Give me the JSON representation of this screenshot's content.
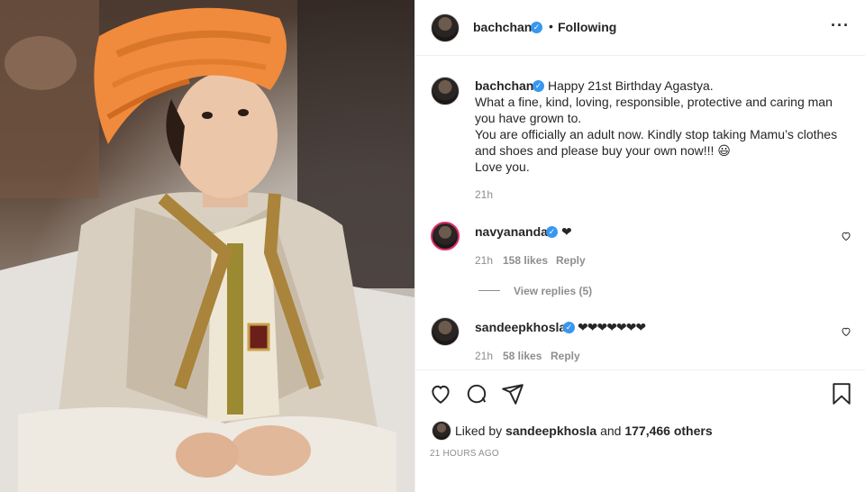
{
  "post": {
    "author": "bachchan",
    "follow_status": "Following",
    "caption_user": "bachchan",
    "caption_lines": [
      "Happy 21st Birthday Agastya.",
      "What a fine, kind, loving, responsible, protective and caring man",
      "you have grown to.",
      "You are officially an adult now. Kindly stop taking Mamu’s clothes",
      "and shoes and please buy your own now!!! 😃",
      "Love you."
    ],
    "caption_time": "21h"
  },
  "comments": [
    {
      "user": "navyananda",
      "text": "❤",
      "time": "21h",
      "likes": "158 likes",
      "reply": "Reply",
      "view_replies": "View replies (5)"
    },
    {
      "user": "sandeepkhosla",
      "text": "❤❤❤❤❤❤❤",
      "time": "21h",
      "likes": "58 likes",
      "reply": "Reply"
    }
  ],
  "footer": {
    "liked_prefix": "Liked by ",
    "liked_user": "sandeepkhosla",
    "liked_middle": " and ",
    "liked_count": "177,466 others",
    "time_ago": "21 HOURS AGO"
  },
  "icons": {
    "like": "heart-icon",
    "comment": "comment-icon",
    "share": "share-icon",
    "save": "bookmark-icon",
    "more": "more-options-icon",
    "verified": "verified-badge-icon"
  },
  "colors": {
    "verified": "#3897f0",
    "turban": "#f08a3c",
    "sherwani": "#d8cfc0"
  }
}
